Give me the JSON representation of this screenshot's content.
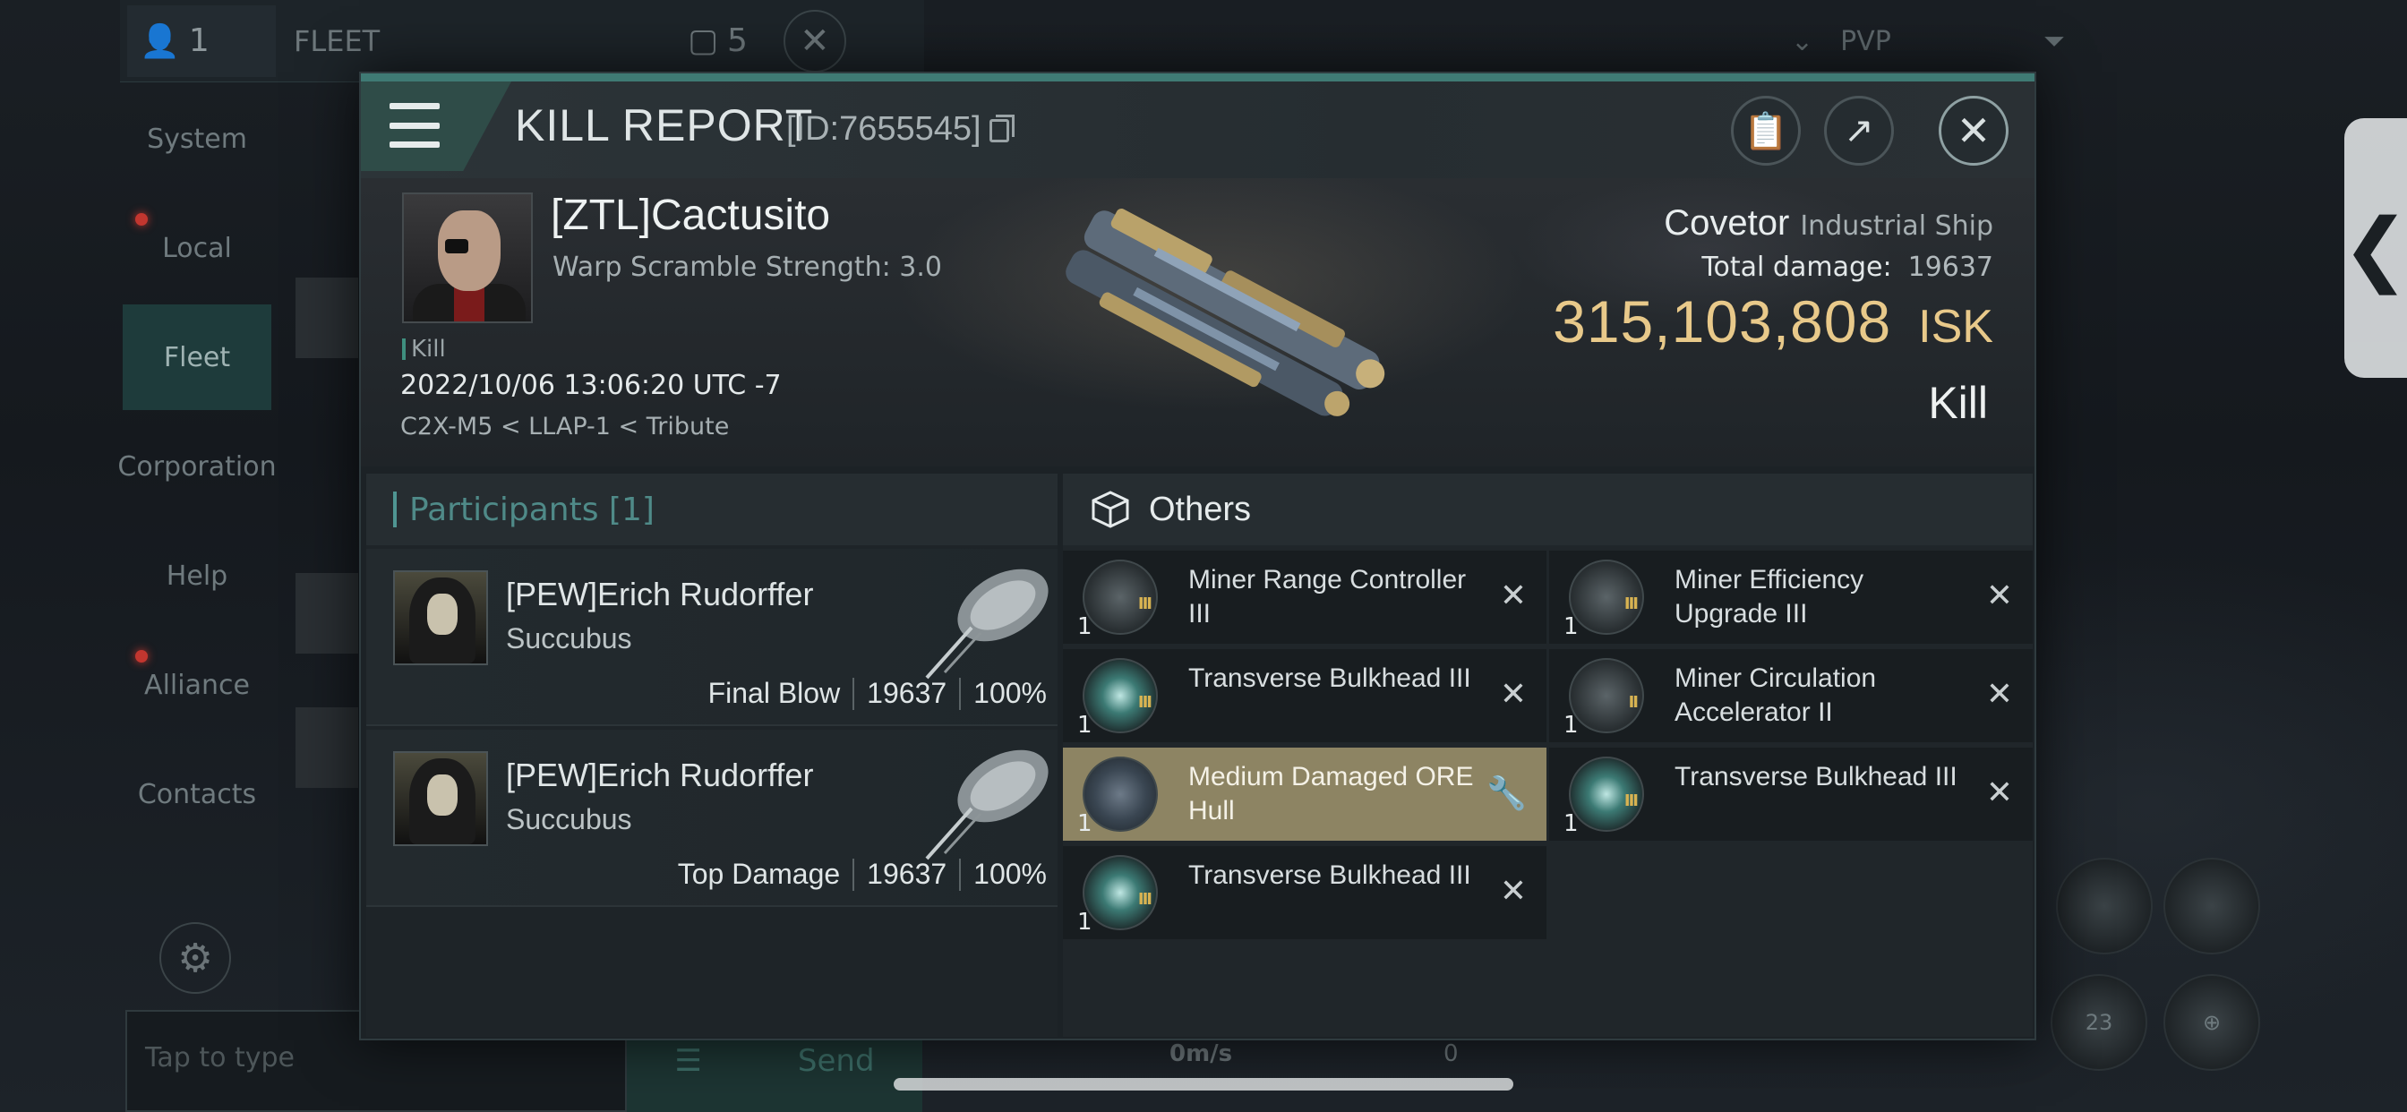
{
  "background": {
    "chat": {
      "member_count": "1",
      "fleet_tab": "FLEET",
      "members_count": "5",
      "channels": [
        {
          "label": "System",
          "active": false,
          "alert": false
        },
        {
          "label": "Local",
          "active": false,
          "alert": true
        },
        {
          "label": "Fleet",
          "active": true,
          "alert": false
        },
        {
          "label": "Corporation",
          "active": false,
          "alert": false
        },
        {
          "label": "Help",
          "active": false,
          "alert": false
        },
        {
          "label": "Alliance",
          "active": false,
          "alert": true
        },
        {
          "label": "Contacts",
          "active": false,
          "alert": false
        }
      ],
      "input_placeholder": "Tap to type",
      "send_label": "Send"
    },
    "filter_label": "PVP",
    "side_tab_glyph": "❮",
    "speed": "0m/s",
    "speed_extra": "0",
    "module_count": "23"
  },
  "modal": {
    "title": "KILL REPORT",
    "id_text": "[ID:7655545]",
    "victim": {
      "name": "[ZTL]Cactusito",
      "warp_scramble": "Warp Scramble Strength: 3.0",
      "tag": "Kill",
      "time": "2022/10/06 13:06:20 UTC -7",
      "location": "C2X-M5 < LLAP-1 < Tribute",
      "ship_name": "Covetor",
      "ship_class": "Industrial Ship",
      "total_damage_label": "Total damage:",
      "total_damage": "19637",
      "isk_value": "315,103,808",
      "isk_unit": "ISK",
      "result": "Kill"
    },
    "participants": {
      "header": "Participants [1]",
      "rows": [
        {
          "name": "[PEW]Erich Rudorffer",
          "ship": "Succubus",
          "role": "Final Blow",
          "damage": "19637",
          "percent": "100%"
        },
        {
          "name": "[PEW]Erich Rudorffer",
          "ship": "Succubus",
          "role": "Top Damage",
          "damage": "19637",
          "percent": "100%"
        }
      ]
    },
    "items": {
      "header": "Others",
      "list": [
        {
          "qty": "1",
          "name": "Miner Range Controller III",
          "icon": "miner-module-icon",
          "status": "destroyed"
        },
        {
          "qty": "1",
          "name": "Miner Efficiency Upgrade III",
          "icon": "miner-module-icon",
          "status": "destroyed"
        },
        {
          "qty": "1",
          "name": "Transverse Bulkhead III",
          "icon": "bulkhead-icon",
          "status": "destroyed"
        },
        {
          "qty": "1",
          "name": "Miner Circulation Accelerator II",
          "icon": "miner-module-icon",
          "status": "destroyed"
        },
        {
          "qty": "1",
          "name": "Medium Damaged ORE Hull",
          "icon": "ore-hull-icon",
          "status": "dropped"
        },
        {
          "qty": "1",
          "name": "Transverse Bulkhead III",
          "icon": "bulkhead-icon",
          "status": "destroyed"
        },
        {
          "qty": "1",
          "name": "Transverse Bulkhead III",
          "icon": "bulkhead-icon",
          "status": "destroyed"
        }
      ]
    }
  },
  "colors": {
    "accent_teal": "#3f7a74",
    "isk_gold": "#e8c98a",
    "highlight_item": "#8d8463"
  }
}
